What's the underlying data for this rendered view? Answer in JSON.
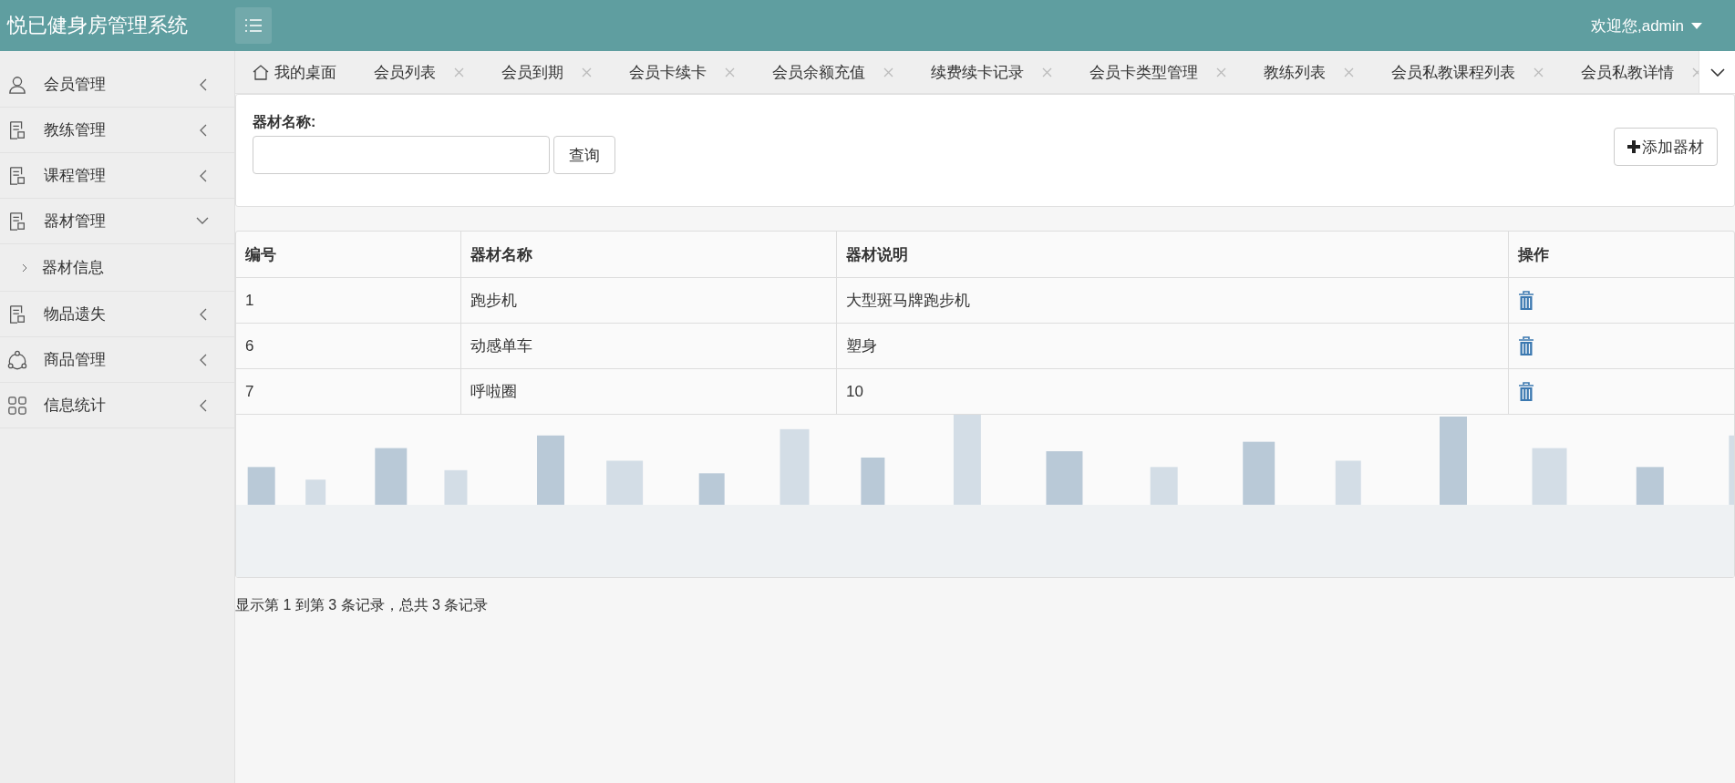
{
  "header": {
    "title": "悦已健身房管理系统",
    "user": "欢迎您,admin"
  },
  "sidebar": {
    "items": [
      {
        "label": "会员管理",
        "kind": "user",
        "expanded": false
      },
      {
        "label": "教练管理",
        "kind": "doc",
        "expanded": false
      },
      {
        "label": "课程管理",
        "kind": "doc",
        "expanded": false
      },
      {
        "label": "器材管理",
        "kind": "doc",
        "expanded": true,
        "children": [
          {
            "label": "器材信息"
          }
        ]
      },
      {
        "label": "物品遗失",
        "kind": "doc",
        "expanded": false
      },
      {
        "label": "商品管理",
        "kind": "share",
        "expanded": false
      },
      {
        "label": "信息统计",
        "kind": "grid",
        "expanded": false
      }
    ]
  },
  "tabs": [
    {
      "label": "我的桌面",
      "kind": "home"
    },
    {
      "label": "会员列表",
      "kind": "closable"
    },
    {
      "label": "会员到期",
      "kind": "closable"
    },
    {
      "label": "会员卡续卡",
      "kind": "closable"
    },
    {
      "label": "会员余额充值",
      "kind": "closable"
    },
    {
      "label": "续费续卡记录",
      "kind": "closable"
    },
    {
      "label": "会员卡类型管理",
      "kind": "closable"
    },
    {
      "label": "教练列表",
      "kind": "closable"
    },
    {
      "label": "会员私教课程列表",
      "kind": "closable"
    },
    {
      "label": "会员私教详情",
      "kind": "closable"
    }
  ],
  "search": {
    "label": "器材名称:",
    "button": "查询",
    "add_button": "添加器材"
  },
  "table": {
    "columns": [
      "编号",
      "器材名称",
      "器材说明",
      "操作"
    ],
    "rows": [
      [
        "1",
        "跑步机",
        "大型斑马牌跑步机"
      ],
      [
        "6",
        "动感单车",
        "塑身"
      ],
      [
        "7",
        "呼啦圈",
        "10"
      ]
    ]
  },
  "footer": "显示第 1 到第 3 条记录，总共 3 条记录"
}
